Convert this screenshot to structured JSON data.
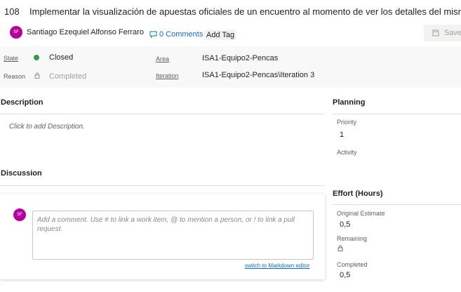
{
  "work_item": {
    "id": "108",
    "title": "Implementar la visualización de apuestas oficiales de un encuentro al momento de ver los detalles del mismo",
    "author_initials": "SF",
    "author_name": "Santiago Ezequiel Alfonso Ferraro",
    "comments_label": "0 Comments",
    "add_tag_label": "Add Tag",
    "save_label": "Save"
  },
  "fields": {
    "state_label": "State",
    "state_value": "Closed",
    "reason_label": "Reason",
    "reason_value": "Completed",
    "area_label": "Area",
    "area_value": "ISA1-Equipo2-Pencas",
    "iteration_label": "Iteration",
    "iteration_value": "ISA1-Equipo2-Pencas\\Iteration 3"
  },
  "description": {
    "heading": "Description",
    "placeholder": "Click to add Description."
  },
  "discussion": {
    "heading": "Discussion",
    "avatar_initials": "SF",
    "comment_placeholder": "Add a comment. Use # to link a work item, @ to mention a person, or ! to link a pull request.",
    "markdown_link": "switch to Markdown editor"
  },
  "planning": {
    "heading": "Planning",
    "priority_label": "Priority",
    "priority_value": "1",
    "activity_label": "Activity"
  },
  "effort": {
    "heading": "Effort (Hours)",
    "original_label": "Original Estimate",
    "original_value": "0,5",
    "remaining_label": "Remaining",
    "completed_label": "Completed",
    "completed_value": "0,5"
  },
  "colors": {
    "state_closed": "#339947",
    "avatar": "#b4009e",
    "link": "#106ebe"
  }
}
